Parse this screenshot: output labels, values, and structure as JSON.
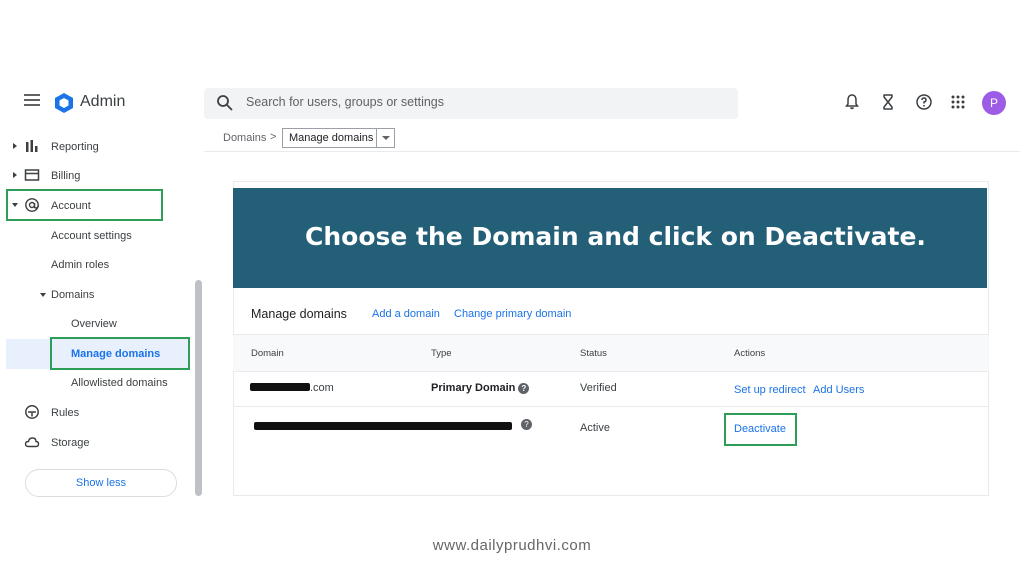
{
  "header": {
    "app_title": "Admin",
    "search_placeholder": "Search for users, groups or settings",
    "avatar_letter": "P",
    "icons": [
      "notifications-icon",
      "tasks-hourglass-icon",
      "help-icon",
      "apps-grid-icon"
    ]
  },
  "breadcrumb": {
    "root": "Domains",
    "separator": ">",
    "current": "Manage domains"
  },
  "sidebar": {
    "items": [
      {
        "label": "Reporting",
        "icon": "bar-chart-icon"
      },
      {
        "label": "Billing",
        "icon": "credit-card-icon"
      },
      {
        "label": "Account",
        "icon": "at-sign-icon"
      },
      {
        "label": "Account settings"
      },
      {
        "label": "Admin roles"
      },
      {
        "label": "Domains"
      },
      {
        "label": "Overview"
      },
      {
        "label": "Manage domains",
        "selected": true
      },
      {
        "label": "Allowlisted domains"
      },
      {
        "label": "Rules",
        "icon": "rules-icon"
      },
      {
        "label": "Storage",
        "icon": "cloud-icon"
      }
    ],
    "show_less": "Show less"
  },
  "banner": {
    "text": "Choose the Domain and click on Deactivate."
  },
  "card": {
    "title": "Manage domains",
    "add_domain": "Add a domain",
    "change_primary": "Change primary domain",
    "columns": [
      "Domain",
      "Type",
      "Status",
      "Actions"
    ],
    "rows": [
      {
        "domain_suffix": ".com",
        "type": "Primary Domain",
        "status": "Verified",
        "actions": [
          "Set up redirect",
          "Add Users"
        ]
      },
      {
        "domain_suffix": "",
        "type": "",
        "status": "Active",
        "actions": [
          "Deactivate"
        ]
      }
    ]
  },
  "footer": {
    "url": "www.dailyprudhvi.com"
  },
  "colors": {
    "banner": "#245f78",
    "highlight": "#2e9d57",
    "link": "#1a73e8",
    "avatar": "#9c5ce6"
  }
}
